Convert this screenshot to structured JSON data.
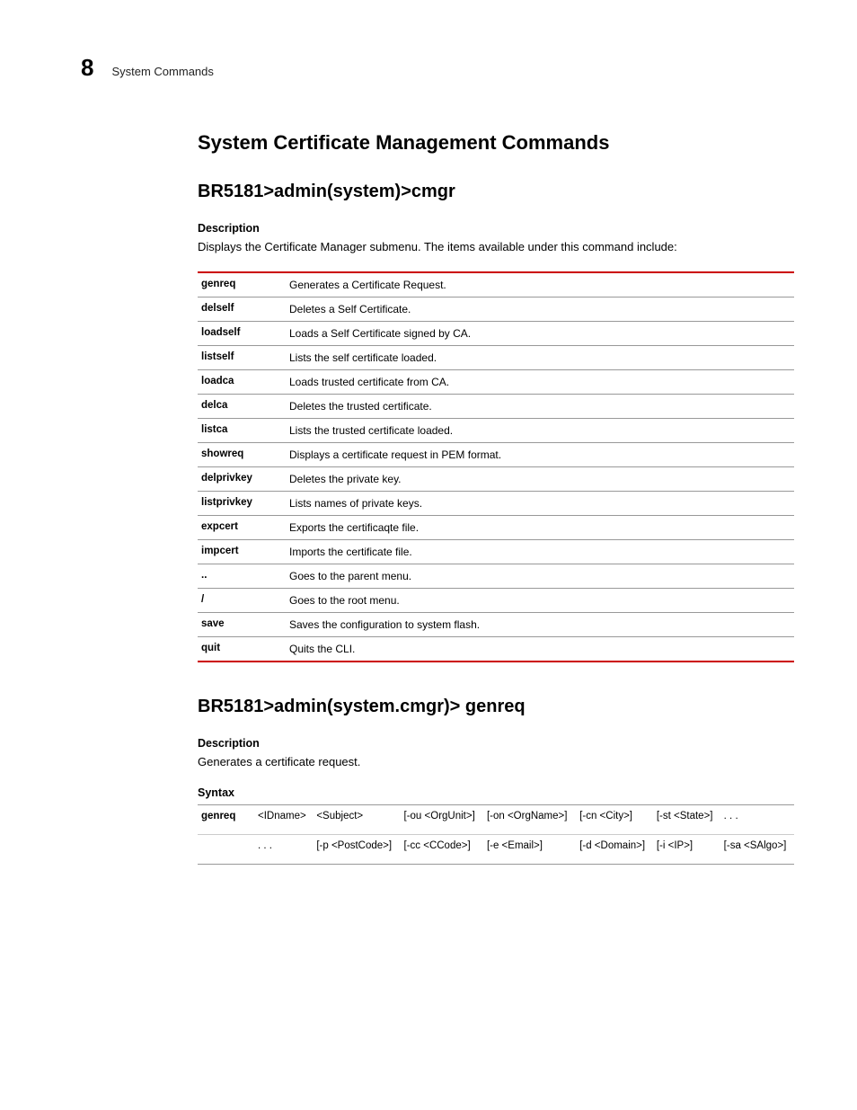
{
  "header": {
    "page_number": "8",
    "breadcrumb": "System Commands"
  },
  "section_title": "System Certificate Management Commands",
  "cmgr": {
    "path": "BR5181>admin(system)>cmgr",
    "desc_label": "Description",
    "desc_text": "Displays the Certificate Manager submenu. The items available under this command include:",
    "rows": [
      {
        "cmd": "genreq",
        "txt": "Generates a Certificate Request."
      },
      {
        "cmd": "delself",
        "txt": "Deletes a Self Certificate."
      },
      {
        "cmd": "loadself",
        "txt": "Loads a Self Certificate signed by CA."
      },
      {
        "cmd": "listself",
        "txt": "Lists the self certificate loaded."
      },
      {
        "cmd": "loadca",
        "txt": "Loads trusted certificate from CA."
      },
      {
        "cmd": "delca",
        "txt": "Deletes the trusted certificate."
      },
      {
        "cmd": "listca",
        "txt": "Lists the trusted certificate loaded."
      },
      {
        "cmd": "showreq",
        "txt": "Displays a certificate request in PEM format."
      },
      {
        "cmd": "delprivkey",
        "txt": "Deletes the private key."
      },
      {
        "cmd": "listprivkey",
        "txt": "Lists names of private keys."
      },
      {
        "cmd": "expcert",
        "txt": "Exports the certificaqte file."
      },
      {
        "cmd": "impcert",
        "txt": "Imports the certificate file."
      },
      {
        "cmd": "..",
        "txt": "Goes to the parent menu."
      },
      {
        "cmd": "/",
        "txt": "Goes to the root menu."
      },
      {
        "cmd": "save",
        "txt": "Saves the configuration to system flash."
      },
      {
        "cmd": "quit",
        "txt": "Quits the CLI."
      }
    ]
  },
  "genreq": {
    "path": "BR5181>admin(system.cmgr)> genreq",
    "desc_label": "Description",
    "desc_text": "Generates a certificate request.",
    "syntax_label": "Syntax",
    "syntax_rows": [
      {
        "c0": "genreq",
        "c1": "<IDname>",
        "c2": "<Subject>",
        "c3": "[-ou <OrgUnit>]",
        "c4": "[-on <OrgName>]",
        "c5": "[-cn <City>]",
        "c6": "[-st <State>]",
        "c7": ". . ."
      },
      {
        "c0": "",
        "c1": ". . .",
        "c2": "[-p <PostCode>]",
        "c3": "[-cc <CCode>]",
        "c4": "[-e <Email>]",
        "c5": "[-d <Domain>]",
        "c6": "[-i <IP>]",
        "c7": "[-sa <SAlgo>]"
      }
    ]
  }
}
